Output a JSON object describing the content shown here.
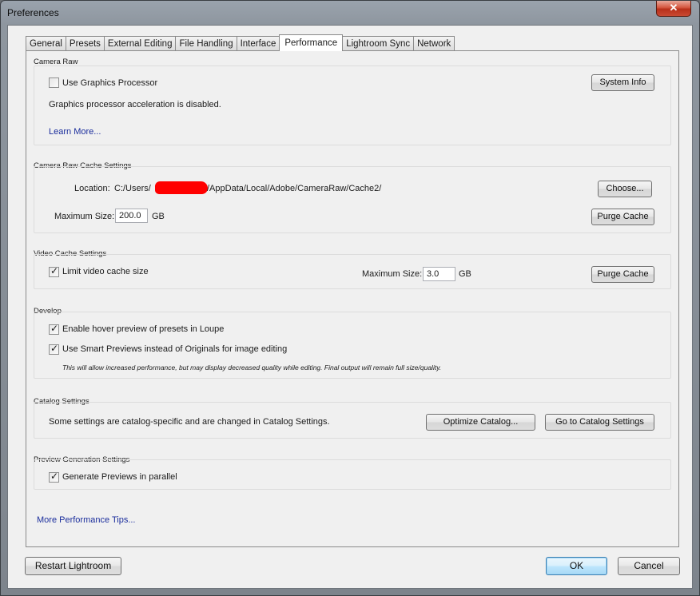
{
  "window": {
    "title": "Preferences",
    "close_glyph": "✕"
  },
  "tabs": [
    {
      "label": "General"
    },
    {
      "label": "Presets"
    },
    {
      "label": "External Editing"
    },
    {
      "label": "File Handling"
    },
    {
      "label": "Interface"
    },
    {
      "label": "Performance",
      "active": true
    },
    {
      "label": "Lightroom Sync"
    },
    {
      "label": "Network"
    }
  ],
  "camera_raw": {
    "heading": "Camera Raw",
    "use_gpu_label": "Use Graphics Processor",
    "use_gpu_checked": false,
    "system_info_button": "System Info",
    "status_text": "Graphics processor acceleration is disabled.",
    "learn_more": "Learn More..."
  },
  "cache": {
    "heading": "Camera Raw Cache Settings",
    "location_label": "Location:",
    "location_prefix": "C:/Users/",
    "location_suffix": "/AppData/Local/Adobe/CameraRaw/Cache2/",
    "choose_button": "Choose...",
    "max_size_label": "Maximum Size:",
    "max_size_value": "200.0",
    "unit": "GB",
    "purge_button": "Purge Cache"
  },
  "video_cache": {
    "heading": "Video Cache Settings",
    "limit_label": "Limit video cache size",
    "limit_checked": true,
    "max_size_label": "Maximum Size:",
    "max_size_value": "3.0",
    "unit": "GB",
    "purge_button": "Purge Cache"
  },
  "develop": {
    "heading": "Develop",
    "hover_label": "Enable hover preview of presets in Loupe",
    "hover_checked": true,
    "smart_label": "Use Smart Previews instead of Originals for image editing",
    "smart_checked": true,
    "note": "This will allow increased performance, but may display decreased quality while editing. Final output will remain full size/quality."
  },
  "catalog": {
    "heading": "Catalog Settings",
    "text": "Some settings are catalog-specific and are changed in Catalog Settings.",
    "optimize_button": "Optimize Catalog...",
    "goto_button": "Go to Catalog Settings"
  },
  "preview": {
    "heading": "Preview Generation Settings",
    "parallel_label": "Generate Previews in parallel",
    "parallel_checked": true
  },
  "more_tips": "More Performance Tips...",
  "footer": {
    "restart_button": "Restart Lightroom",
    "ok_button": "OK",
    "cancel_button": "Cancel"
  },
  "check_glyph": "✓"
}
